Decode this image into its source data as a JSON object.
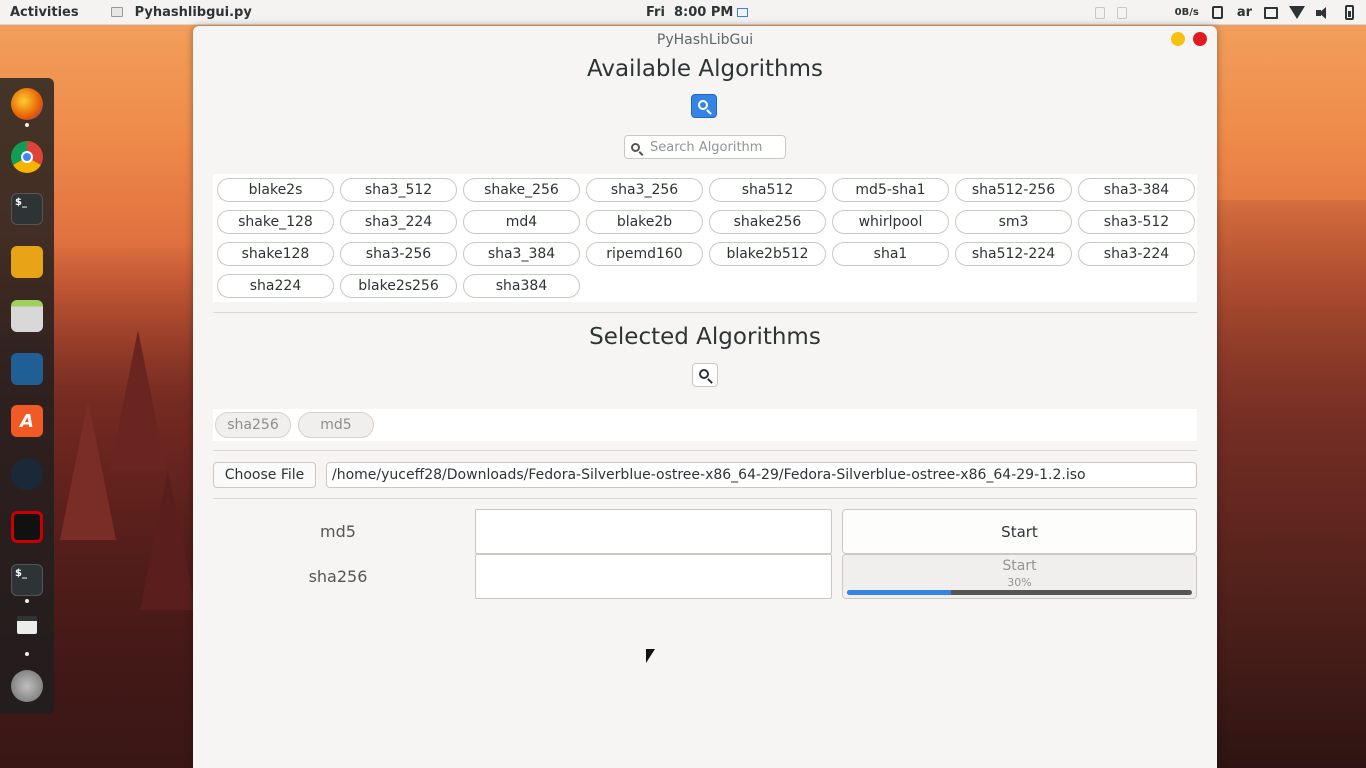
{
  "topbar": {
    "activities": "Activities",
    "app_name": "Pyhashlibgui.py",
    "day": "Fri",
    "time": "8:00 PM",
    "netspeed": "0B/s",
    "keyboard_layout": "ar"
  },
  "dock": {
    "items": [
      {
        "name": "firefox-icon",
        "color": "#e66000"
      },
      {
        "name": "chrome-icon",
        "color": "#4285f4"
      },
      {
        "name": "terminal-icon",
        "color": "#2e3436"
      },
      {
        "name": "jenkins-icon",
        "color": "#f0b400"
      },
      {
        "name": "files-icon",
        "color": "#8e8e8e"
      },
      {
        "name": "screenshot-icon",
        "color": "#1f6fb5"
      },
      {
        "name": "acrobat-icon",
        "color": "#f15a24"
      },
      {
        "name": "steam-icon",
        "color": "#1b2838"
      },
      {
        "name": "red-app-icon",
        "color": "#cc0000"
      },
      {
        "name": "terminal-2-icon",
        "color": "#2e3436"
      },
      {
        "name": "window-icon",
        "color": "#ececec"
      },
      {
        "name": "launcher-icon",
        "color": "#6b6b6b"
      }
    ]
  },
  "window": {
    "title": "PyHashLibGui",
    "available_heading": "Available Algorithms",
    "search_placeholder": "Search Algorithm",
    "available_algorithms": [
      "blake2s",
      "sha3_512",
      "shake_256",
      "sha3_256",
      "sha512",
      "md5-sha1",
      "sha512-256",
      "sha3-384",
      "shake_128",
      "sha3_224",
      "md4",
      "blake2b",
      "shake256",
      "whirlpool",
      "sm3",
      "sha3-512",
      "shake128",
      "sha3-256",
      "sha3_384",
      "ripemd160",
      "blake2b512",
      "sha1",
      "sha512-224",
      "sha3-224",
      "sha224",
      "blake2s256",
      "sha384"
    ],
    "selected_heading": "Selected Algorithms",
    "selected_algorithms": [
      "sha256",
      "md5"
    ],
    "choose_file_label": "Choose File",
    "file_path": "/home/yuceff28/Downloads/Fedora-Silverblue-ostree-x86_64-29/Fedora-Silverblue-ostree-x86_64-29-1.2.iso",
    "rows": [
      {
        "algorithm": "md5",
        "hash": "",
        "button": "Start",
        "state": "idle"
      },
      {
        "algorithm": "sha256",
        "hash": "",
        "button": "Start",
        "state": "running",
        "progress_label": "30%",
        "progress": 0.3
      }
    ]
  },
  "colors": {
    "accent": "#3584e4",
    "close": "#e01b24",
    "minimize": "#f5c211"
  }
}
